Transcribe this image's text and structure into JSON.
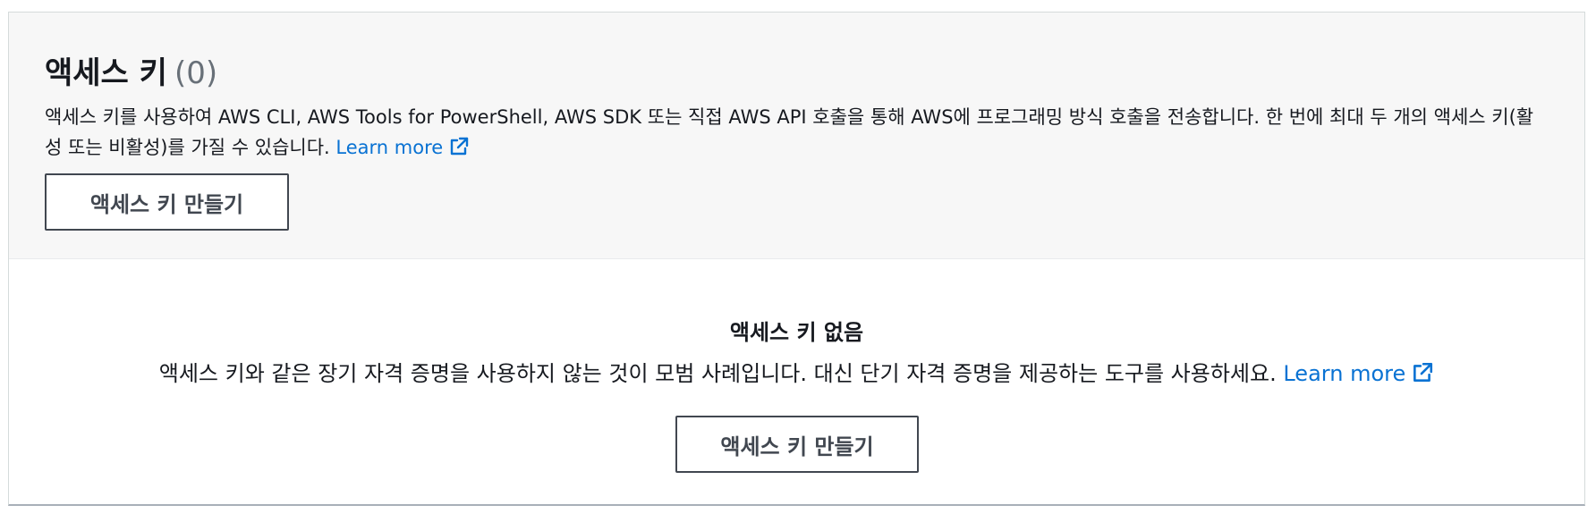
{
  "header": {
    "title": "액세스 키",
    "count": "(0)",
    "description": "액세스 키를 사용하여 AWS CLI, AWS Tools for PowerShell, AWS SDK 또는 직접 AWS API 호출을 통해 AWS에 프로그래밍 방식 호출을 전송합니다. 한 번에 최대 두 개의 액세스 키(활성 또는 비활성)를 가질 수 있습니다.",
    "learn_more": "Learn more",
    "create_button": "액세스 키 만들기"
  },
  "empty_state": {
    "title": "액세스 키 없음",
    "description": "액세스 키와 같은 장기 자격 증명을 사용하지 않는 것이 모범 사례입니다. 대신 단기 자격 증명을 제공하는 도구를 사용하세요.",
    "learn_more": "Learn more",
    "create_button": "액세스 키 만들기"
  },
  "icons": {
    "learn_more_icon": "external-link-icon"
  },
  "colors": {
    "link": "#0972d3",
    "header_background": "#f7f7f7",
    "button_border": "#414750",
    "count_text": "#687078"
  }
}
